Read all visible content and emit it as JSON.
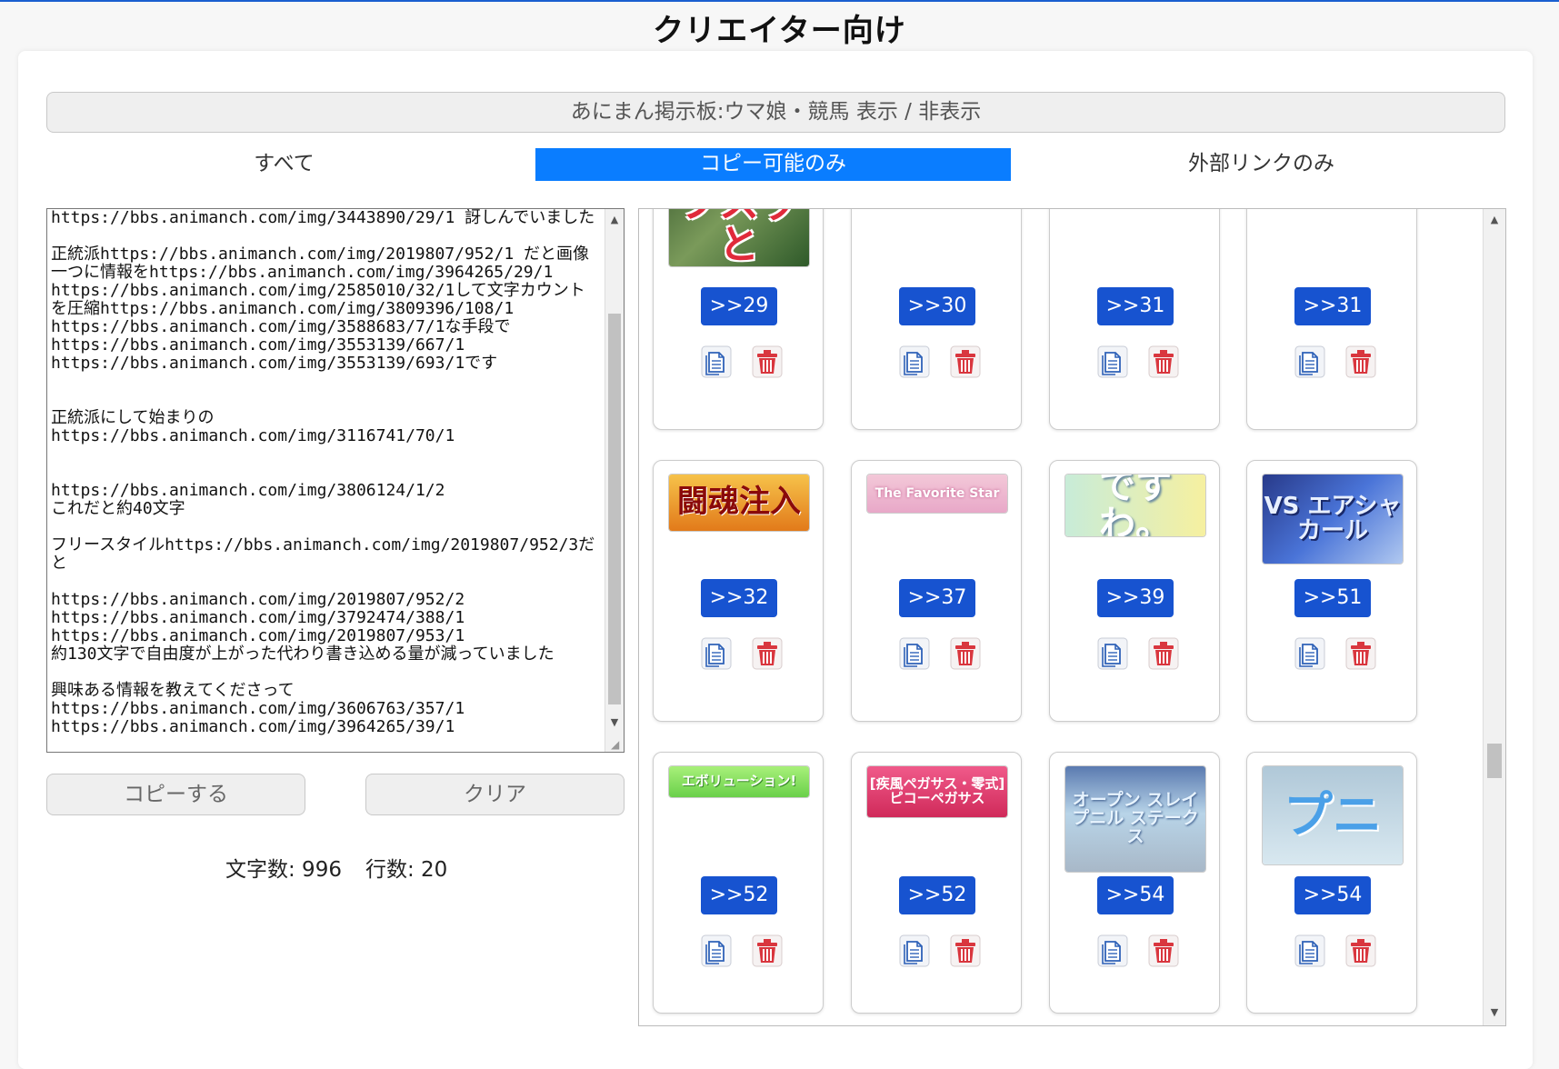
{
  "page_title": "クリエイター向け",
  "toggle_label": "あにまん掲示板:ウマ娘・競馬 表示 / 非表示",
  "tabs": [
    {
      "label": "すべて",
      "active": false
    },
    {
      "label": "コピー可能のみ",
      "active": true
    },
    {
      "label": "外部リンクのみ",
      "active": false
    }
  ],
  "editor": {
    "text": "https://bbs.animanch.com/img/3443890/29/1 訝しんでいました\n\n正統派https://bbs.animanch.com/img/2019807/952/1 だと画像一つに情報をhttps://bbs.animanch.com/img/3964265/29/1\nhttps://bbs.animanch.com/img/2585010/32/1して文字カウントを圧縮https://bbs.animanch.com/img/3809396/108/1\nhttps://bbs.animanch.com/img/3588683/7/1な手段で\nhttps://bbs.animanch.com/img/3553139/667/1\nhttps://bbs.animanch.com/img/3553139/693/1です\n\n\n正統派にして始まりの\nhttps://bbs.animanch.com/img/3116741/70/1\n\n\nhttps://bbs.animanch.com/img/3806124/1/2\nこれだと約40文字\n\nフリースタイルhttps://bbs.animanch.com/img/2019807/952/3だと\n\nhttps://bbs.animanch.com/img/2019807/952/2\nhttps://bbs.animanch.com/img/3792474/388/1\nhttps://bbs.animanch.com/img/2019807/953/1\n約130文字で自由度が上がった代わり書き込める量が減っていました\n\n興味ある情報を教えてくださって\nhttps://bbs.animanch.com/img/3606763/357/1\nhttps://bbs.animanch.com/img/3964265/39/1"
  },
  "buttons": {
    "copy": "コピーする",
    "clear": "クリア"
  },
  "counts": {
    "chars": "文字数: 996",
    "lines": "行数: 20"
  },
  "colors": {
    "accent": "#0a7dff",
    "res_button": "#1753d0",
    "delete_icon": "#d9363e",
    "copy_icon": "#2f62b8"
  },
  "gallery": {
    "rows": [
      [
        {
          "res": ">>29",
          "thumb_text": "ブスッと"
        },
        {
          "res": ">>30",
          "thumb_text": ""
        },
        {
          "res": ">>31",
          "thumb_text": ""
        },
        {
          "res": ">>31",
          "thumb_text": ""
        }
      ],
      [
        {
          "res": ">>32",
          "thumb_text": "闘魂注入"
        },
        {
          "res": ">>37",
          "thumb_text": "The Favorite Star"
        },
        {
          "res": ">>39",
          "thumb_text": "ですわ。"
        },
        {
          "res": ">>51",
          "thumb_text": "VS エアシャカール"
        }
      ],
      [
        {
          "res": ">>52",
          "thumb_text": "エボリューション!"
        },
        {
          "res": ">>52",
          "thumb_text": "[疾風ペガサス・零式] ピコーペガサス"
        },
        {
          "res": ">>54",
          "thumb_text": "オープン スレイプニル ステークス"
        },
        {
          "res": ">>54",
          "thumb_text": "プニ"
        }
      ]
    ]
  }
}
